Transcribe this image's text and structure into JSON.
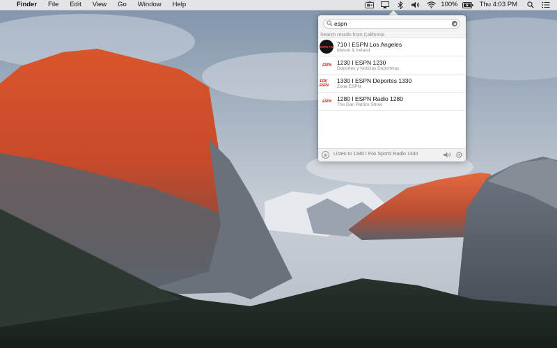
{
  "menubar": {
    "apple_glyph": "",
    "app_name": "Finder",
    "menus": [
      "File",
      "Edit",
      "View",
      "Go",
      "Window",
      "Help"
    ],
    "status_icons": [
      "radio-icon",
      "airplay-icon",
      "bluetooth-icon",
      "volume-icon",
      "wifi-icon",
      "battery-icon",
      "spotlight-icon",
      "notification-center-icon"
    ],
    "battery_percent": "100%",
    "clock": "Thu 4:03 PM"
  },
  "popover": {
    "search_value": "espn",
    "results_header": "Search results from California",
    "results": [
      {
        "title": "710 I ESPN Los Angeles",
        "subtitle": "Mason & Ireland",
        "logo_text": "ESPN 710",
        "logo_style": "round"
      },
      {
        "title": "1230 I ESPN 1230",
        "subtitle": "Deportes y Noticias Deportivas",
        "logo_text": "ESPN",
        "logo_style": "flat"
      },
      {
        "title": "1330 I ESPN Deportes 1330",
        "subtitle": "Zona ESPN",
        "logo_text": "1330 ESPN",
        "logo_style": "flat"
      },
      {
        "title": "1280 I ESPN Radio 1280",
        "subtitle": "The Dan Patrick Show",
        "logo_text": "ESPN",
        "logo_style": "flat"
      }
    ],
    "footer": {
      "now_playing": "Listen to 1340 I Fox Sports Radio 1340"
    }
  },
  "colors": {
    "espn_red": "#d8161b",
    "menubar_bg": "#ebebee",
    "popover_bg": "#ffffff"
  }
}
